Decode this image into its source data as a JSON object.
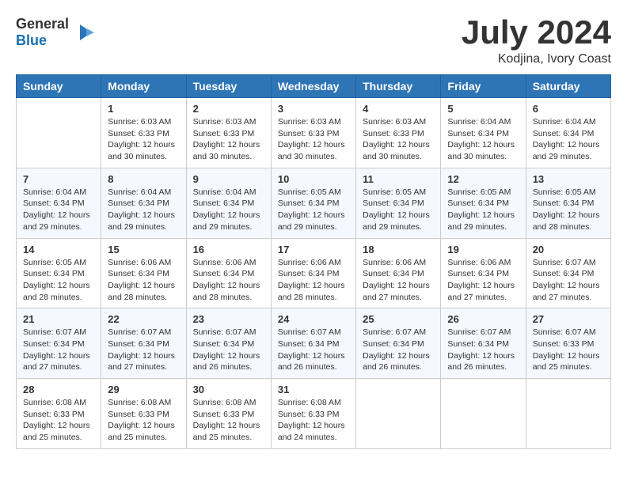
{
  "header": {
    "logo_general": "General",
    "logo_blue": "Blue",
    "month": "July 2024",
    "location": "Kodjina, Ivory Coast"
  },
  "weekdays": [
    "Sunday",
    "Monday",
    "Tuesday",
    "Wednesday",
    "Thursday",
    "Friday",
    "Saturday"
  ],
  "weeks": [
    [
      {
        "day": "",
        "sunrise": "",
        "sunset": "",
        "daylight": ""
      },
      {
        "day": "1",
        "sunrise": "6:03 AM",
        "sunset": "6:33 PM",
        "daylight": "12 hours and 30 minutes."
      },
      {
        "day": "2",
        "sunrise": "6:03 AM",
        "sunset": "6:33 PM",
        "daylight": "12 hours and 30 minutes."
      },
      {
        "day": "3",
        "sunrise": "6:03 AM",
        "sunset": "6:33 PM",
        "daylight": "12 hours and 30 minutes."
      },
      {
        "day": "4",
        "sunrise": "6:03 AM",
        "sunset": "6:33 PM",
        "daylight": "12 hours and 30 minutes."
      },
      {
        "day": "5",
        "sunrise": "6:04 AM",
        "sunset": "6:34 PM",
        "daylight": "12 hours and 30 minutes."
      },
      {
        "day": "6",
        "sunrise": "6:04 AM",
        "sunset": "6:34 PM",
        "daylight": "12 hours and 29 minutes."
      }
    ],
    [
      {
        "day": "7",
        "sunrise": "6:04 AM",
        "sunset": "6:34 PM",
        "daylight": "12 hours and 29 minutes."
      },
      {
        "day": "8",
        "sunrise": "6:04 AM",
        "sunset": "6:34 PM",
        "daylight": "12 hours and 29 minutes."
      },
      {
        "day": "9",
        "sunrise": "6:04 AM",
        "sunset": "6:34 PM",
        "daylight": "12 hours and 29 minutes."
      },
      {
        "day": "10",
        "sunrise": "6:05 AM",
        "sunset": "6:34 PM",
        "daylight": "12 hours and 29 minutes."
      },
      {
        "day": "11",
        "sunrise": "6:05 AM",
        "sunset": "6:34 PM",
        "daylight": "12 hours and 29 minutes."
      },
      {
        "day": "12",
        "sunrise": "6:05 AM",
        "sunset": "6:34 PM",
        "daylight": "12 hours and 29 minutes."
      },
      {
        "day": "13",
        "sunrise": "6:05 AM",
        "sunset": "6:34 PM",
        "daylight": "12 hours and 28 minutes."
      }
    ],
    [
      {
        "day": "14",
        "sunrise": "6:05 AM",
        "sunset": "6:34 PM",
        "daylight": "12 hours and 28 minutes."
      },
      {
        "day": "15",
        "sunrise": "6:06 AM",
        "sunset": "6:34 PM",
        "daylight": "12 hours and 28 minutes."
      },
      {
        "day": "16",
        "sunrise": "6:06 AM",
        "sunset": "6:34 PM",
        "daylight": "12 hours and 28 minutes."
      },
      {
        "day": "17",
        "sunrise": "6:06 AM",
        "sunset": "6:34 PM",
        "daylight": "12 hours and 28 minutes."
      },
      {
        "day": "18",
        "sunrise": "6:06 AM",
        "sunset": "6:34 PM",
        "daylight": "12 hours and 27 minutes."
      },
      {
        "day": "19",
        "sunrise": "6:06 AM",
        "sunset": "6:34 PM",
        "daylight": "12 hours and 27 minutes."
      },
      {
        "day": "20",
        "sunrise": "6:07 AM",
        "sunset": "6:34 PM",
        "daylight": "12 hours and 27 minutes."
      }
    ],
    [
      {
        "day": "21",
        "sunrise": "6:07 AM",
        "sunset": "6:34 PM",
        "daylight": "12 hours and 27 minutes."
      },
      {
        "day": "22",
        "sunrise": "6:07 AM",
        "sunset": "6:34 PM",
        "daylight": "12 hours and 27 minutes."
      },
      {
        "day": "23",
        "sunrise": "6:07 AM",
        "sunset": "6:34 PM",
        "daylight": "12 hours and 26 minutes."
      },
      {
        "day": "24",
        "sunrise": "6:07 AM",
        "sunset": "6:34 PM",
        "daylight": "12 hours and 26 minutes."
      },
      {
        "day": "25",
        "sunrise": "6:07 AM",
        "sunset": "6:34 PM",
        "daylight": "12 hours and 26 minutes."
      },
      {
        "day": "26",
        "sunrise": "6:07 AM",
        "sunset": "6:34 PM",
        "daylight": "12 hours and 26 minutes."
      },
      {
        "day": "27",
        "sunrise": "6:07 AM",
        "sunset": "6:33 PM",
        "daylight": "12 hours and 25 minutes."
      }
    ],
    [
      {
        "day": "28",
        "sunrise": "6:08 AM",
        "sunset": "6:33 PM",
        "daylight": "12 hours and 25 minutes."
      },
      {
        "day": "29",
        "sunrise": "6:08 AM",
        "sunset": "6:33 PM",
        "daylight": "12 hours and 25 minutes."
      },
      {
        "day": "30",
        "sunrise": "6:08 AM",
        "sunset": "6:33 PM",
        "daylight": "12 hours and 25 minutes."
      },
      {
        "day": "31",
        "sunrise": "6:08 AM",
        "sunset": "6:33 PM",
        "daylight": "12 hours and 24 minutes."
      },
      {
        "day": "",
        "sunrise": "",
        "sunset": "",
        "daylight": ""
      },
      {
        "day": "",
        "sunrise": "",
        "sunset": "",
        "daylight": ""
      },
      {
        "day": "",
        "sunrise": "",
        "sunset": "",
        "daylight": ""
      }
    ]
  ]
}
